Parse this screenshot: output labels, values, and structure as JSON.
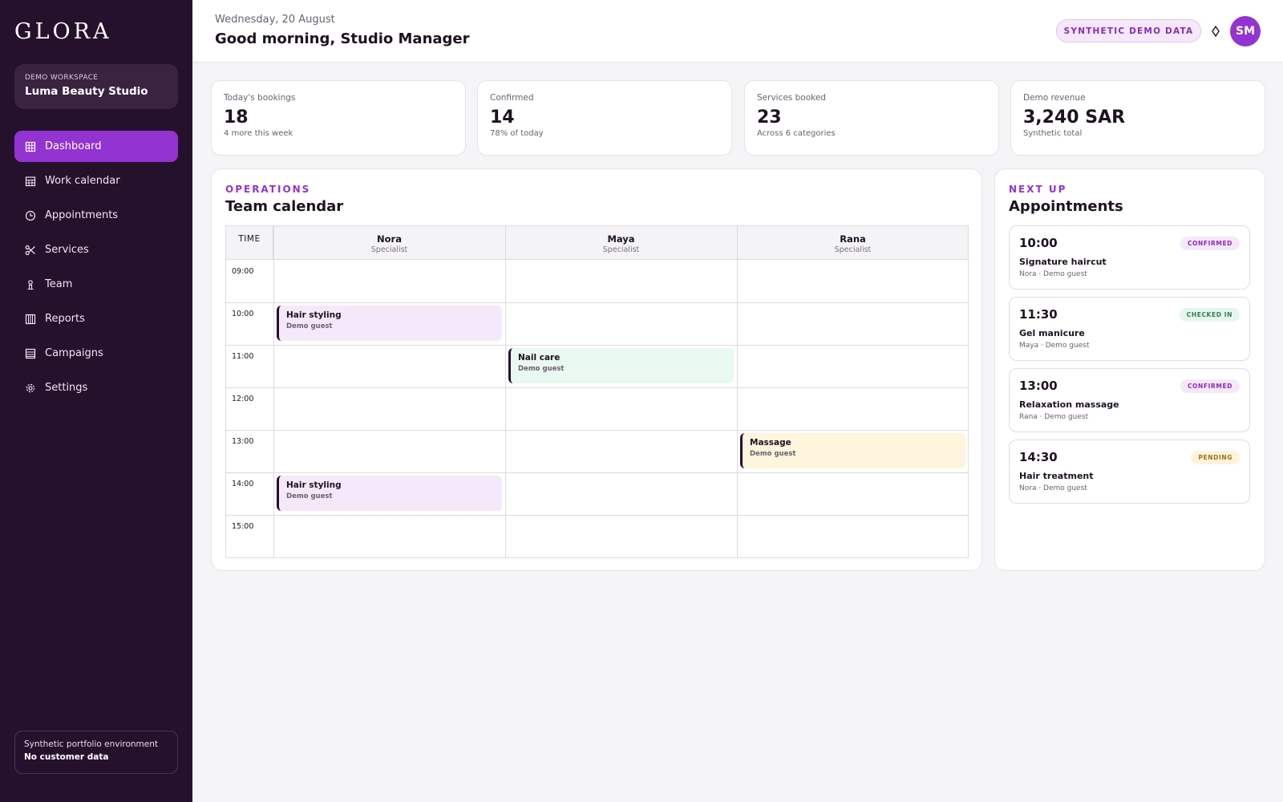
{
  "sidebar": {
    "brand": "GLORA",
    "workspace_label": "DEMO WORKSPACE",
    "workspace_name": "Luma Beauty Studio",
    "items": [
      {
        "label": "Dashboard",
        "icon": "grid-icon",
        "active": true
      },
      {
        "label": "Work calendar",
        "icon": "calendar-icon",
        "active": false
      },
      {
        "label": "Appointments",
        "icon": "clock-icon",
        "active": false
      },
      {
        "label": "Services",
        "icon": "scissors-icon",
        "active": false
      },
      {
        "label": "Team",
        "icon": "person-icon",
        "active": false
      },
      {
        "label": "Reports",
        "icon": "chart-icon",
        "active": false
      },
      {
        "label": "Campaigns",
        "icon": "list-icon",
        "active": false
      },
      {
        "label": "Settings",
        "icon": "gear-icon",
        "active": false
      }
    ],
    "environment_line1": "Synthetic portfolio environment",
    "environment_line2": "No customer data"
  },
  "header": {
    "date": "Wednesday, 20 August",
    "greeting": "Good morning, Studio Manager",
    "demo_badge": "SYNTHETIC DEMO DATA",
    "theme_icon": "diamond-icon",
    "avatar_initials": "SM"
  },
  "stats": [
    {
      "label": "Today's bookings",
      "value": "18",
      "sub": "4 more this week"
    },
    {
      "label": "Confirmed",
      "value": "14",
      "sub": "78% of today"
    },
    {
      "label": "Services booked",
      "value": "23",
      "sub": "Across 6 categories"
    },
    {
      "label": "Demo revenue",
      "value": "3,240 SAR",
      "sub": "Synthetic total"
    }
  ],
  "calendar": {
    "eyebrow": "OPERATIONS",
    "title": "Team calendar",
    "time_header": "TIME",
    "staff": [
      {
        "name": "Nora",
        "role": "Specialist"
      },
      {
        "name": "Maya",
        "role": "Specialist"
      },
      {
        "name": "Rana",
        "role": "Specialist"
      }
    ],
    "times": [
      "09:00",
      "10:00",
      "11:00",
      "12:00",
      "13:00",
      "14:00",
      "15:00"
    ],
    "events": [
      {
        "staff": 0,
        "slot": 1,
        "title": "Hair styling",
        "sub": "Demo guest",
        "color": "#f6e8fb"
      },
      {
        "staff": 1,
        "slot": 2,
        "title": "Nail care",
        "sub": "Demo guest",
        "color": "#e9f8f1"
      },
      {
        "staff": 2,
        "slot": 4,
        "title": "Massage",
        "sub": "Demo guest",
        "color": "#fff4dc"
      },
      {
        "staff": 0,
        "slot": 5,
        "title": "Hair styling",
        "sub": "Demo guest",
        "color": "#f6e8fb"
      }
    ]
  },
  "appointments": {
    "eyebrow": "NEXT UP",
    "title": "Appointments",
    "items": [
      {
        "time": "10:00",
        "status": "CONFIRMED",
        "status_kind": "confirmed",
        "service": "Signature haircut",
        "meta": "Nora · Demo guest"
      },
      {
        "time": "11:30",
        "status": "CHECKED IN",
        "status_kind": "checked",
        "service": "Gel manicure",
        "meta": "Maya · Demo guest"
      },
      {
        "time": "13:00",
        "status": "CONFIRMED",
        "status_kind": "confirmed",
        "service": "Relaxation massage",
        "meta": "Rana · Demo guest"
      },
      {
        "time": "14:30",
        "status": "PENDING",
        "status_kind": "pending",
        "service": "Hair treatment",
        "meta": "Nora · Demo guest"
      }
    ]
  },
  "colors": {
    "sidebar_bg": "#26112d",
    "accent": "#9333d1",
    "confirmed_bg": "#f6e8fb",
    "confirmed_fg": "#8a2bb8",
    "checked_bg": "#e6f6ee",
    "checked_fg": "#2f7a52",
    "pending_bg": "#fff3d9",
    "pending_fg": "#a0701a"
  }
}
